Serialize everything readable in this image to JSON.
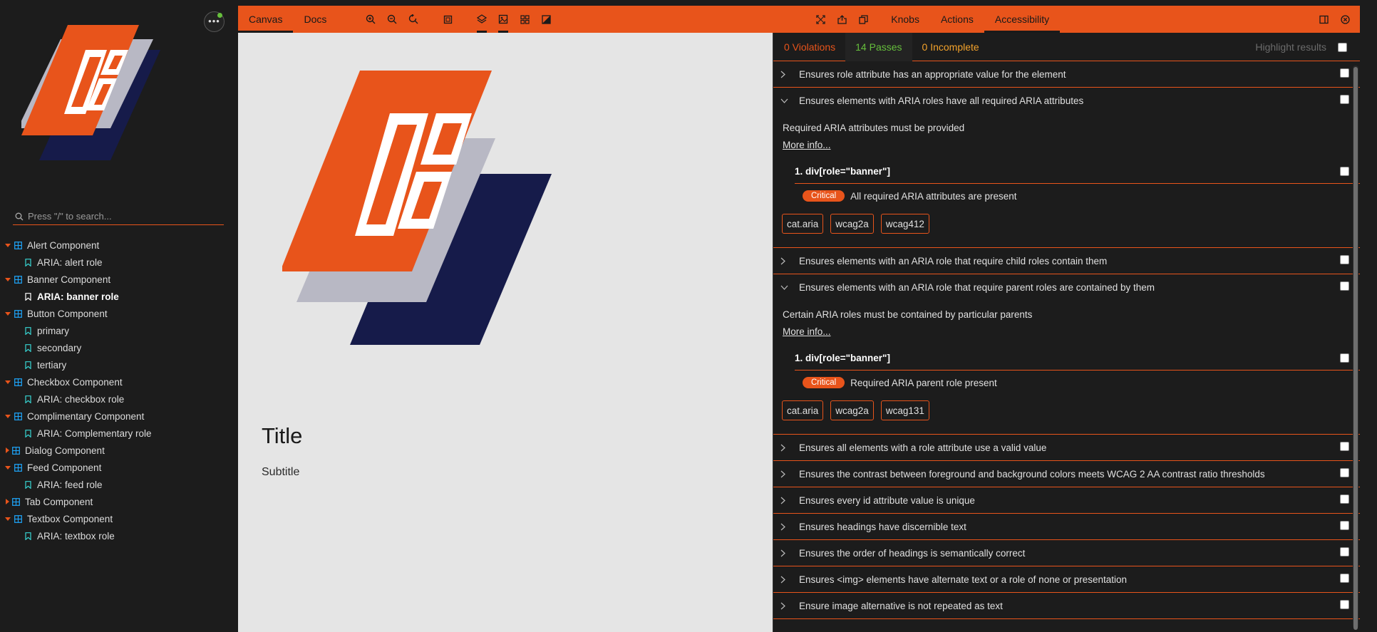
{
  "colors": {
    "accent": "#e8541b",
    "pass": "#66bf3c",
    "incomplete": "#f3a22b",
    "navy": "#161b4a",
    "grey": "#b8b8c4"
  },
  "sidebar": {
    "search_placeholder": "Press \"/\" to search...",
    "menu_glyph": "•••",
    "tree": [
      {
        "type": "component",
        "label": "Alert Component",
        "expanded": true
      },
      {
        "type": "story",
        "label": "ARIA: alert role"
      },
      {
        "type": "component",
        "label": "Banner Component",
        "expanded": true
      },
      {
        "type": "story",
        "label": "ARIA: banner role",
        "active": true
      },
      {
        "type": "component",
        "label": "Button Component",
        "expanded": true
      },
      {
        "type": "story",
        "label": "primary"
      },
      {
        "type": "story",
        "label": "secondary"
      },
      {
        "type": "story",
        "label": "tertiary"
      },
      {
        "type": "component",
        "label": "Checkbox Component",
        "expanded": true
      },
      {
        "type": "story",
        "label": "ARIA: checkbox role"
      },
      {
        "type": "component",
        "label": "Complimentary Component",
        "expanded": true
      },
      {
        "type": "story",
        "label": "ARIA: Complementary role"
      },
      {
        "type": "component",
        "label": "Dialog Component",
        "expanded": false
      },
      {
        "type": "component",
        "label": "Feed Component",
        "expanded": true
      },
      {
        "type": "story",
        "label": "ARIA: feed role"
      },
      {
        "type": "component",
        "label": "Tab Component",
        "expanded": false
      },
      {
        "type": "component",
        "label": "Textbox Component",
        "expanded": true
      },
      {
        "type": "story",
        "label": "ARIA: textbox role"
      }
    ]
  },
  "toolbar": {
    "tabs": {
      "canvas": "Canvas",
      "docs": "Docs"
    },
    "icons": [
      "zoom-in-icon",
      "zoom-out-icon",
      "zoom-reset-icon",
      "background-icon",
      "grid-icon",
      "viewport-icon",
      "outline-icon",
      "measure-icon"
    ],
    "right_icons": [
      "fullscreen-icon",
      "share-icon",
      "copy-icon"
    ],
    "addon_tabs": {
      "knobs": "Knobs",
      "actions": "Actions",
      "accessibility": "Accessibility"
    }
  },
  "canvas": {
    "title": "Title",
    "subtitle": "Subtitle"
  },
  "accessibility": {
    "summary": {
      "violations": "0 Violations",
      "passes": "14 Passes",
      "incomplete": "0 Incomplete"
    },
    "highlight_label": "Highlight results",
    "rules": [
      {
        "text": "Ensures role attribute has an appropriate value for the element",
        "expanded": false
      },
      {
        "text": "Ensures elements with ARIA roles have all required ARIA attributes",
        "expanded": true,
        "description": "Required ARIA attributes must be provided",
        "more": "More info...",
        "node": "1. div[role=\"banner\"]",
        "impact": "Critical",
        "result": "All required ARIA attributes are present",
        "tags": [
          "cat.aria",
          "wcag2a",
          "wcag412"
        ]
      },
      {
        "text": "Ensures elements with an ARIA role that require child roles contain them",
        "expanded": false
      },
      {
        "text": "Ensures elements with an ARIA role that require parent roles are contained by them",
        "expanded": true,
        "description": "Certain ARIA roles must be contained by particular parents",
        "more": "More info...",
        "node": "1. div[role=\"banner\"]",
        "impact": "Critical",
        "result": "Required ARIA parent role present",
        "tags": [
          "cat.aria",
          "wcag2a",
          "wcag131"
        ]
      },
      {
        "text": "Ensures all elements with a role attribute use a valid value",
        "expanded": false
      },
      {
        "text": "Ensures the contrast between foreground and background colors meets WCAG 2 AA contrast ratio thresholds",
        "expanded": false
      },
      {
        "text": "Ensures every id attribute value is unique",
        "expanded": false
      },
      {
        "text": "Ensures headings have discernible text",
        "expanded": false
      },
      {
        "text": "Ensures the order of headings is semantically correct",
        "expanded": false
      },
      {
        "text": "Ensures <img> elements have alternate text or a role of none or presentation",
        "expanded": false
      },
      {
        "text": "Ensure image alternative is not repeated as text",
        "expanded": false
      }
    ]
  }
}
